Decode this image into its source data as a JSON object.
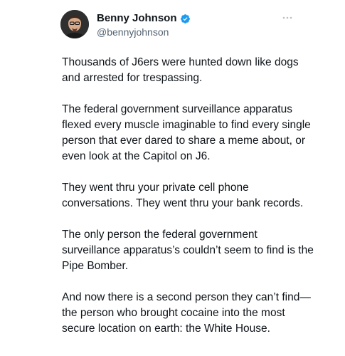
{
  "author": {
    "display_name": "Benny Johnson",
    "handle": "@bennyjohnson",
    "verified": true,
    "verified_color": "#1d9bf0",
    "avatar_icon": "profile-photo"
  },
  "more_icon": "ellipsis-icon",
  "tweet": {
    "paragraphs": [
      "Thousands of J6ers were hunted down like dogs and arrested for trespassing.",
      "The federal government surveillance apparatus flexed every muscle imaginable to find every single person that ever dared to share a meme about, or even look at the Capitol on J6.",
      "They went thru your private cell phone conversations. They went thru your bank records.",
      "The only person the federal government surveillance apparatus’s couldn’t seem to find is the Pipe Bomber.",
      "And now there is a second person they can’t find— the person who brought cocaine into the most secure location on earth: the White House."
    ]
  }
}
